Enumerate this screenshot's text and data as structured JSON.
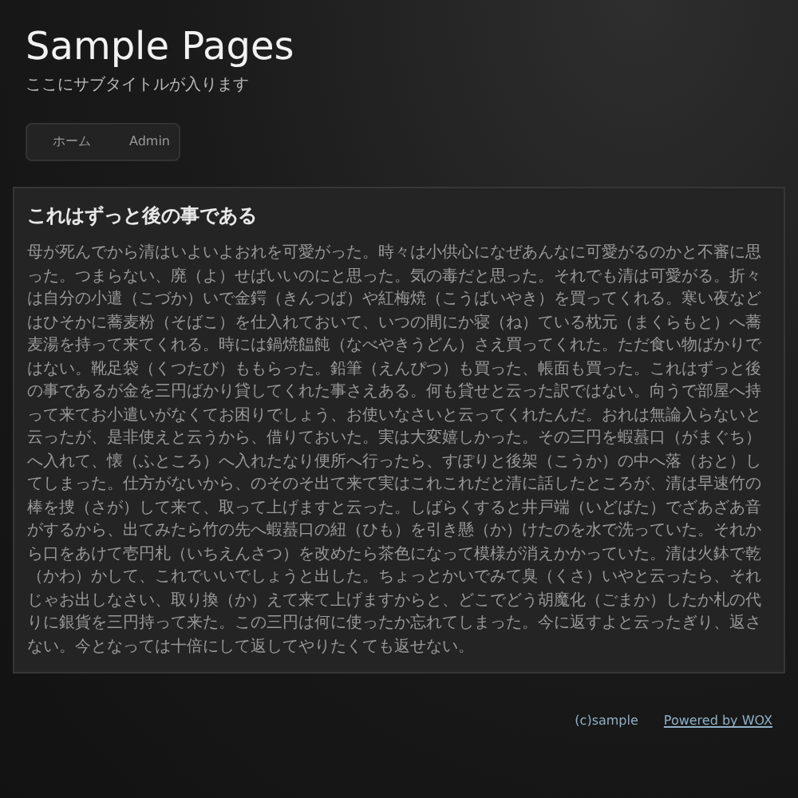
{
  "site": {
    "title": "Sample Pages",
    "subtitle": "ここにサブタイトルが入ります"
  },
  "nav": [
    {
      "label": "ホーム"
    },
    {
      "label": "Admin"
    }
  ],
  "article": {
    "heading": "これはずっと後の事である",
    "body": "母が死んでから清はいよいよおれを可愛がった。時々は小供心になぜあんなに可愛がるのかと不審に思った。つまらない、廃（よ）せばいいのにと思った。気の毒だと思った。それでも清は可愛がる。折々は自分の小遣（こづか）いで金鍔（きんつば）や紅梅焼（こうばいやき）を買ってくれる。寒い夜などはひそかに蕎麦粉（そばこ）を仕入れておいて、いつの間にか寝（ね）ている枕元（まくらもと）へ蕎麦湯を持って来てくれる。時には鍋焼饂飩（なべやきうどん）さえ買ってくれた。ただ食い物ばかりではない。靴足袋（くつたび）ももらった。鉛筆（えんぴつ）も買った、帳面も買った。これはずっと後の事であるが金を三円ばかり貸してくれた事さえある。何も貸せと云った訳ではない。向うで部屋へ持って来てお小遣いがなくてお困りでしょう、お使いなさいと云ってくれたんだ。おれは無論入らないと云ったが、是非使えと云うから、借りておいた。実は大変嬉しかった。その三円を蝦蟇口（がまぐち）へ入れて、懐（ふところ）へ入れたなり便所へ行ったら、すぽりと後架（こうか）の中へ落（おと）してしまった。仕方がないから、のそのそ出て来て実はこれこれだと清に話したところが、清は早速竹の棒を捜（さが）して来て、取って上げますと云った。しばらくすると井戸端（いどばた）でざあざあ音がするから、出てみたら竹の先へ蝦蟇口の紐（ひも）を引き懸（か）けたのを水で洗っていた。それから口をあけて壱円札（いちえんさつ）を改めたら茶色になって模様が消えかかっていた。清は火鉢で乾（かわ）かして、これでいいでしょうと出した。ちょっとかいでみて臭（くさ）いやと云ったら、それじゃお出しなさい、取り換（か）えて来て上げますからと、どこでどう胡魔化（ごまか）したか札の代りに銀貨を三円持って来た。この三円は何に使ったか忘れてしまった。今に返すよと云ったぎり、返さない。今となっては十倍にして返してやりたくても返せない。"
  },
  "footer": {
    "copyright": "(c)sample",
    "link": "Powered by WOX"
  }
}
